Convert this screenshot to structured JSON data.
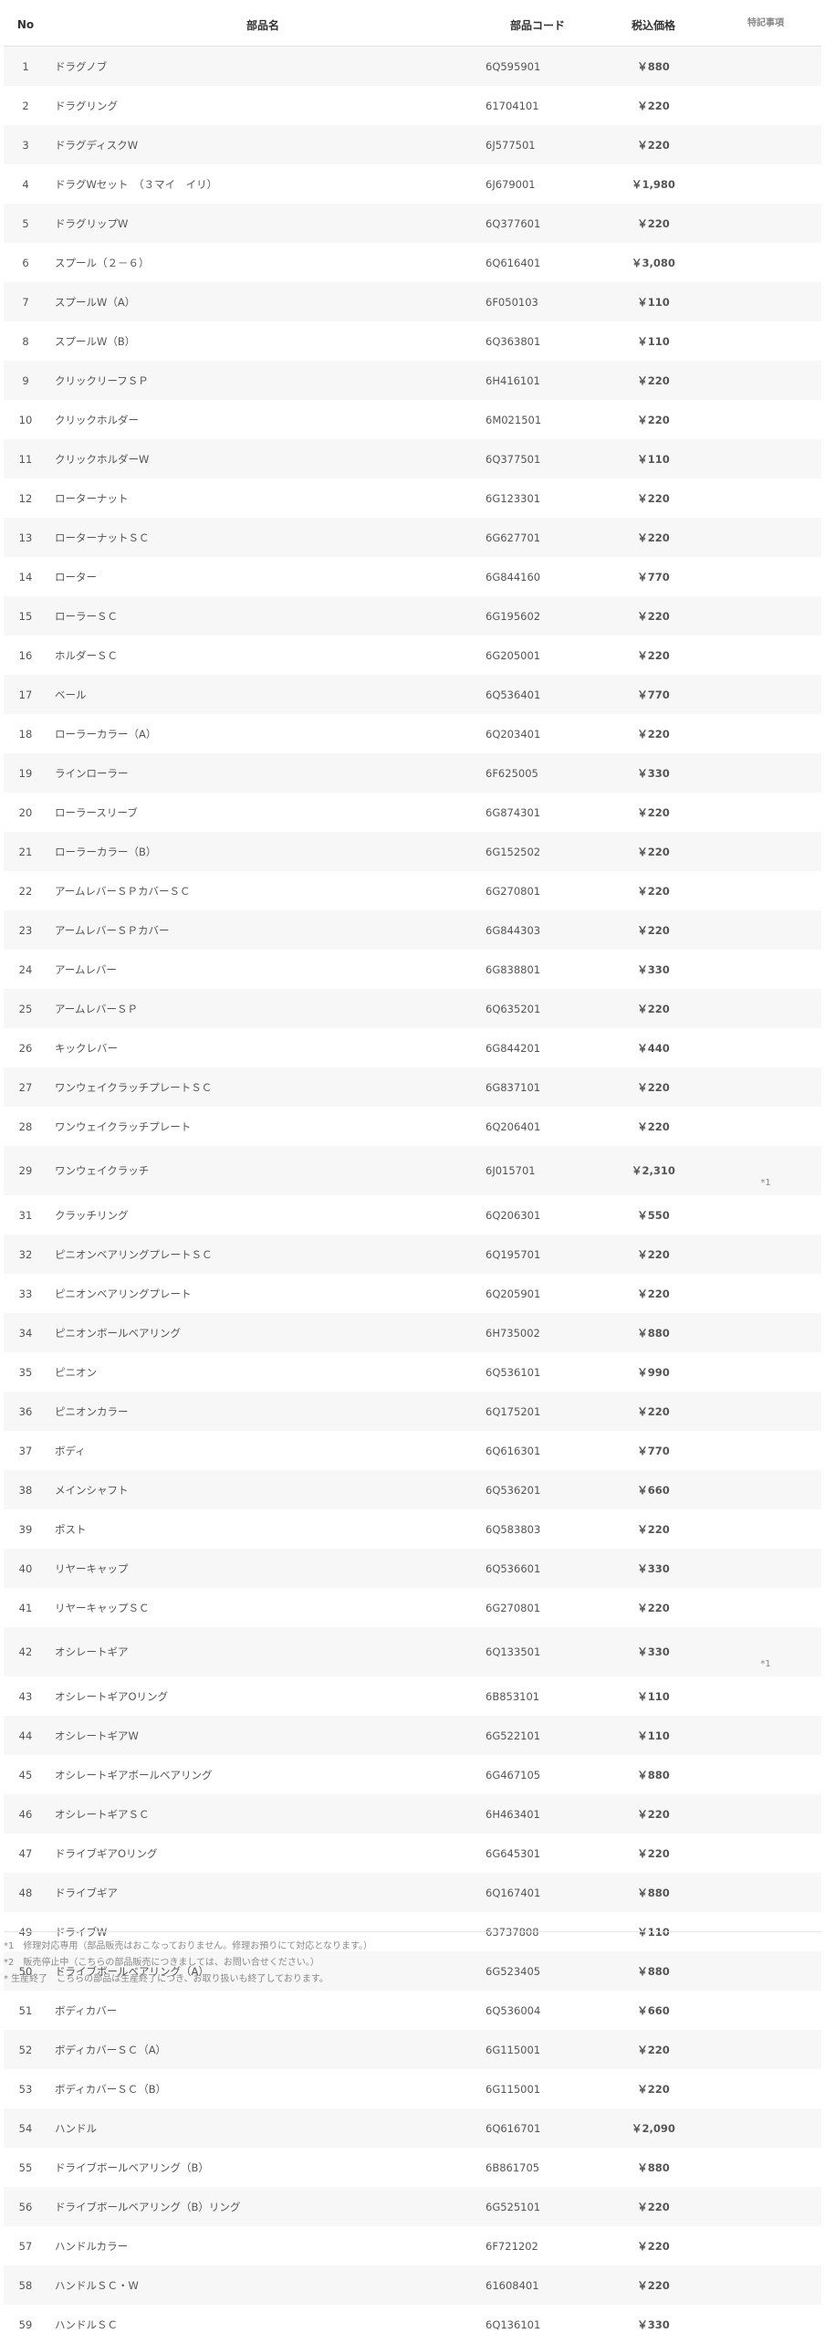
{
  "table": {
    "headers": {
      "no": "No",
      "name": "部品名",
      "code": "部品コード",
      "price": "税込価格",
      "note": "特記事項"
    },
    "rows": [
      {
        "no": "1",
        "name": "ドラグノブ",
        "code": "6Q595901",
        "price": "￥880",
        "note": ""
      },
      {
        "no": "2",
        "name": "ドラグリング",
        "code": "61704101",
        "price": "￥220",
        "note": ""
      },
      {
        "no": "3",
        "name": "ドラグディスクW",
        "code": "6J577501",
        "price": "￥220",
        "note": ""
      },
      {
        "no": "4",
        "name": "ドラグWセット　（３マイ　イリ）",
        "code": "6J679001",
        "price": "￥1,980",
        "note": ""
      },
      {
        "no": "5",
        "name": "ドラグリップW",
        "code": "6Q377601",
        "price": "￥220",
        "note": ""
      },
      {
        "no": "6",
        "name": "スプール（２－６）",
        "code": "6Q616401",
        "price": "￥3,080",
        "note": ""
      },
      {
        "no": "7",
        "name": "スプールW（A）",
        "code": "6F050103",
        "price": "￥110",
        "note": ""
      },
      {
        "no": "8",
        "name": "スプールW（B）",
        "code": "6Q363801",
        "price": "￥110",
        "note": ""
      },
      {
        "no": "9",
        "name": "クリックリーフＳＰ",
        "code": "6H416101",
        "price": "￥220",
        "note": ""
      },
      {
        "no": "10",
        "name": "クリックホルダー",
        "code": "6M021501",
        "price": "￥220",
        "note": ""
      },
      {
        "no": "11",
        "name": "クリックホルダーW",
        "code": "6Q377501",
        "price": "￥110",
        "note": ""
      },
      {
        "no": "12",
        "name": "ローターナット",
        "code": "6G123301",
        "price": "￥220",
        "note": ""
      },
      {
        "no": "13",
        "name": "ローターナットＳＣ",
        "code": "6G627701",
        "price": "￥220",
        "note": ""
      },
      {
        "no": "14",
        "name": "ローター",
        "code": "6G844160",
        "price": "￥770",
        "note": ""
      },
      {
        "no": "15",
        "name": "ローラーＳＣ",
        "code": "6G195602",
        "price": "￥220",
        "note": ""
      },
      {
        "no": "16",
        "name": "ホルダーＳＣ",
        "code": "6G205001",
        "price": "￥220",
        "note": ""
      },
      {
        "no": "17",
        "name": "ベール",
        "code": "6Q536401",
        "price": "￥770",
        "note": ""
      },
      {
        "no": "18",
        "name": "ローラーカラー（A）",
        "code": "6Q203401",
        "price": "￥220",
        "note": ""
      },
      {
        "no": "19",
        "name": "ラインローラー",
        "code": "6F625005",
        "price": "￥330",
        "note": ""
      },
      {
        "no": "20",
        "name": "ローラースリーブ",
        "code": "6G874301",
        "price": "￥220",
        "note": ""
      },
      {
        "no": "21",
        "name": "ローラーカラー（B）",
        "code": "6G152502",
        "price": "￥220",
        "note": ""
      },
      {
        "no": "22",
        "name": "アームレバーＳＰカバーＳＣ",
        "code": "6G270801",
        "price": "￥220",
        "note": ""
      },
      {
        "no": "23",
        "name": "アームレバーＳＰカバー",
        "code": "6G844303",
        "price": "￥220",
        "note": ""
      },
      {
        "no": "24",
        "name": "アームレバー",
        "code": "6G838801",
        "price": "￥330",
        "note": ""
      },
      {
        "no": "25",
        "name": "アームレバーＳＰ",
        "code": "6Q635201",
        "price": "￥220",
        "note": ""
      },
      {
        "no": "26",
        "name": "キックレバー",
        "code": "6G844201",
        "price": "￥440",
        "note": ""
      },
      {
        "no": "27",
        "name": "ワンウェイクラッチプレートＳＣ",
        "code": "6G837101",
        "price": "￥220",
        "note": ""
      },
      {
        "no": "28",
        "name": "ワンウェイクラッチプレート",
        "code": "6Q206401",
        "price": "￥220",
        "note": ""
      },
      {
        "no": "29",
        "name": "ワンウェイクラッチ",
        "code": "6J015701",
        "price": "￥2,310",
        "note": "*1"
      },
      {
        "no": "31",
        "name": "クラッチリング",
        "code": "6Q206301",
        "price": "￥550",
        "note": ""
      },
      {
        "no": "32",
        "name": "ピニオンベアリングプレートＳＣ",
        "code": "6Q195701",
        "price": "￥220",
        "note": ""
      },
      {
        "no": "33",
        "name": "ピニオンベアリングプレート",
        "code": "6Q205901",
        "price": "￥220",
        "note": ""
      },
      {
        "no": "34",
        "name": "ピニオンボールベアリング",
        "code": "6H735002",
        "price": "￥880",
        "note": ""
      },
      {
        "no": "35",
        "name": "ピニオン",
        "code": "6Q536101",
        "price": "￥990",
        "note": ""
      },
      {
        "no": "36",
        "name": "ピニオンカラー",
        "code": "6Q175201",
        "price": "￥220",
        "note": ""
      },
      {
        "no": "37",
        "name": "ボディ",
        "code": "6Q616301",
        "price": "￥770",
        "note": ""
      },
      {
        "no": "38",
        "name": "メインシャフト",
        "code": "6Q536201",
        "price": "￥660",
        "note": ""
      },
      {
        "no": "39",
        "name": "ポスト",
        "code": "6Q583803",
        "price": "￥220",
        "note": ""
      },
      {
        "no": "40",
        "name": "リヤーキャップ",
        "code": "6Q536601",
        "price": "￥330",
        "note": ""
      },
      {
        "no": "41",
        "name": "リヤーキャップＳＣ",
        "code": "6G270801",
        "price": "￥220",
        "note": ""
      },
      {
        "no": "42",
        "name": "オシレートギア",
        "code": "6Q133501",
        "price": "￥330",
        "note": "*1"
      },
      {
        "no": "43",
        "name": "オシレートギアOリング",
        "code": "6B853101",
        "price": "￥110",
        "note": ""
      },
      {
        "no": "44",
        "name": "オシレートギアW",
        "code": "6G522101",
        "price": "￥110",
        "note": ""
      },
      {
        "no": "45",
        "name": "オシレートギアボールベアリング",
        "code": "6G467105",
        "price": "￥880",
        "note": ""
      },
      {
        "no": "46",
        "name": "オシレートギアＳＣ",
        "code": "6H463401",
        "price": "￥220",
        "note": ""
      },
      {
        "no": "47",
        "name": "ドライブギアOリング",
        "code": "6G645301",
        "price": "￥220",
        "note": ""
      },
      {
        "no": "48",
        "name": "ドライブギア",
        "code": "6Q167401",
        "price": "￥880",
        "note": ""
      },
      {
        "no": "49",
        "name": "ドライブW",
        "code": "63737808",
        "price": "￥110",
        "note": ""
      },
      {
        "no": "50",
        "name": "ドライブボールベアリング（A）",
        "code": "6G523405",
        "price": "￥880",
        "note": ""
      },
      {
        "no": "51",
        "name": "ボディカバー",
        "code": "6Q536004",
        "price": "￥660",
        "note": ""
      },
      {
        "no": "52",
        "name": "ボディカバーＳＣ（A）",
        "code": "6G115001",
        "price": "￥220",
        "note": ""
      },
      {
        "no": "53",
        "name": "ボディカバーＳＣ（B）",
        "code": "6G115001",
        "price": "￥220",
        "note": ""
      },
      {
        "no": "54",
        "name": "ハンドル",
        "code": "6Q616701",
        "price": "￥2,090",
        "note": ""
      },
      {
        "no": "55",
        "name": "ドライブボールベアリング（B）",
        "code": "6B861705",
        "price": "￥880",
        "note": ""
      },
      {
        "no": "56",
        "name": "ドライブボールベアリング（B）リング",
        "code": "6G525101",
        "price": "￥220",
        "note": ""
      },
      {
        "no": "57",
        "name": "ハンドルカラー",
        "code": "6F721202",
        "price": "￥220",
        "note": ""
      },
      {
        "no": "58",
        "name": "ハンドルＳＣ・W",
        "code": "61608401",
        "price": "￥220",
        "note": ""
      },
      {
        "no": "59",
        "name": "ハンドルＳＣ",
        "code": "6Q136101",
        "price": "￥330",
        "note": ""
      }
    ]
  },
  "footnotes": [
    "*1　修理対応専用（部品販売はおこなっておりません。修理お預りにて対応となります。）",
    "*2　販売停止中（こちらの部品販売につきましては、お問い合せください。）",
    "* 生産終了　こちらの部品は生産終了につき、お取り扱いも終了しております。"
  ]
}
